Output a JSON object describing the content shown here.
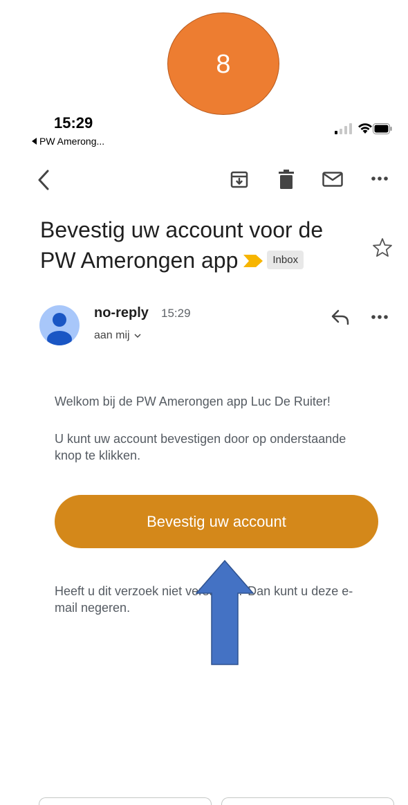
{
  "step_badge": {
    "number": "8",
    "color": "#ED7D31"
  },
  "status_bar": {
    "time": "15:29",
    "back_app": "PW Amerong..."
  },
  "toolbar": {
    "icons": [
      "back-arrow-icon",
      "archive-icon",
      "trash-icon",
      "mark-unread-icon",
      "more-icon"
    ]
  },
  "email": {
    "subject": "Bevestig uw account voor de PW Amerongen app",
    "label": "Inbox",
    "sender": "no-reply",
    "time": "15:29",
    "recipient": "aan mij",
    "body": {
      "welcome": "Welkom bij de PW Amerongen app Luc De Ruiter!",
      "instructions": "U kunt uw account bevestigen door op onderstaande knop te klikken.",
      "button_label": "Bevestig uw account",
      "ignore_note": "Heeft u dit verzoek niet verstuurd? Dan kunt u deze e-mail negeren."
    }
  },
  "colors": {
    "button": "#D4881A",
    "important_marker": "#F7B500",
    "arrow": "#4472C4",
    "avatar": "#A8C7FA"
  }
}
